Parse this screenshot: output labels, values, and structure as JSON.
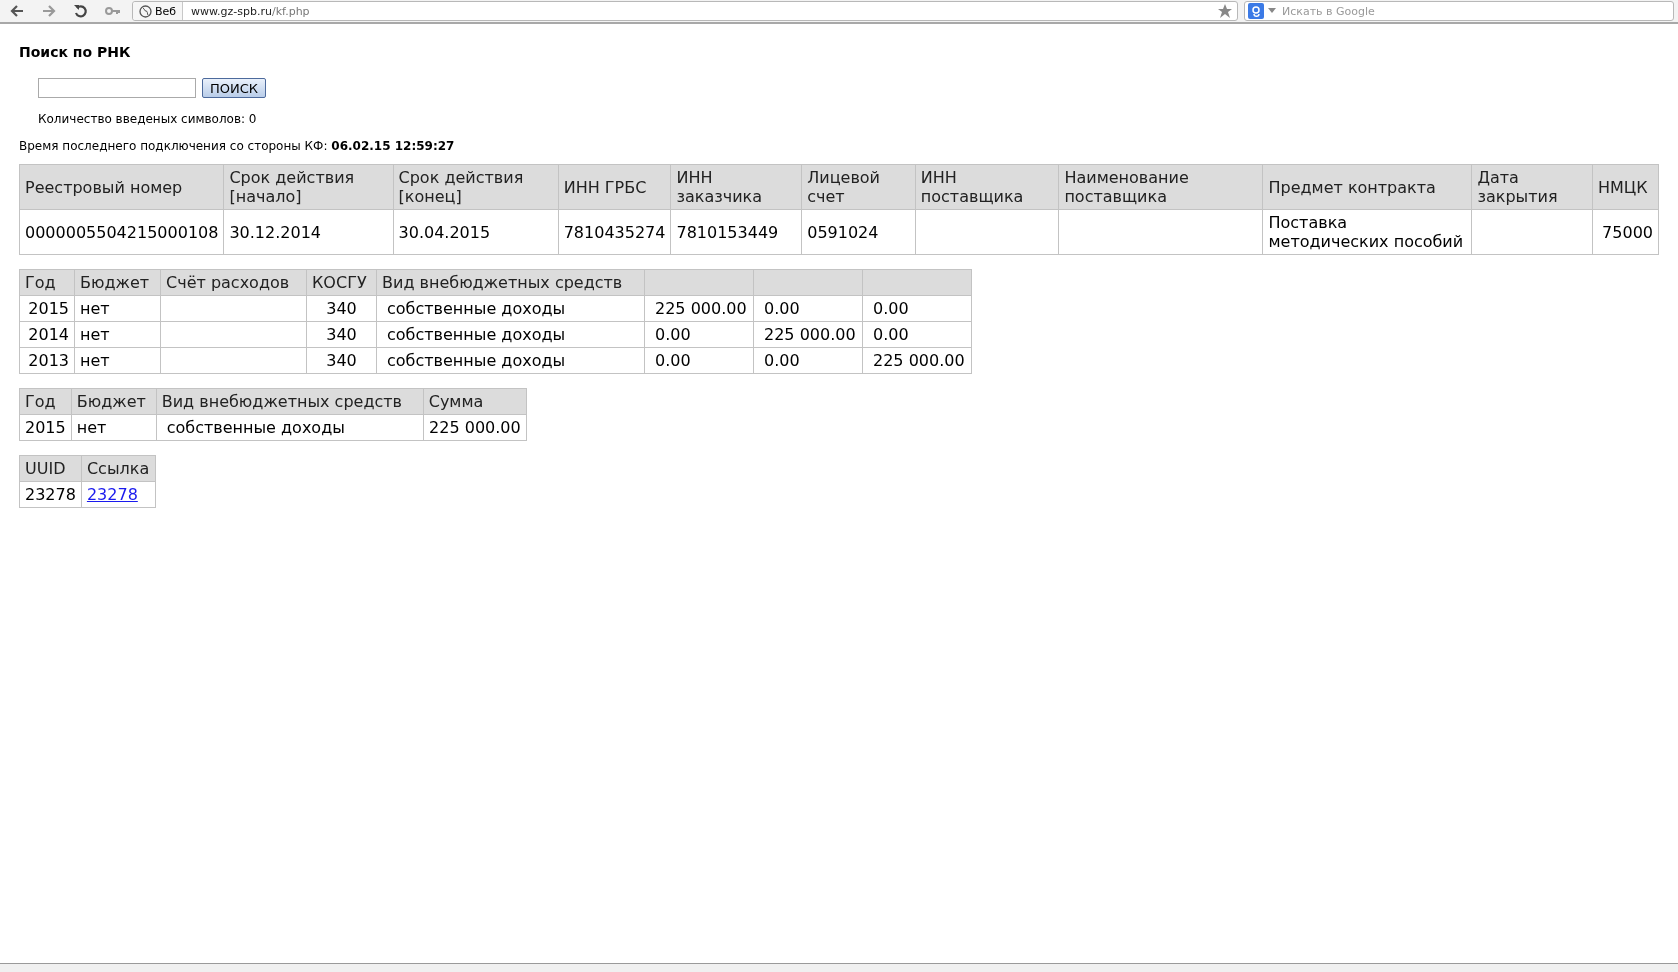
{
  "browser": {
    "search_engine_label": "Веб",
    "url_host": "www.gz-spb.ru",
    "url_path": "/kf.php",
    "web_search": {
      "placeholder": "Искать в Google"
    }
  },
  "page": {
    "title": "Поиск по РНК",
    "search": {
      "button": "ПОИСК"
    },
    "char_count": "Количество введеных символов: 0",
    "connection_label": "Время последнего подключения со стороны КФ:",
    "connection_time": "06.02.15 12:59:27"
  },
  "tables": [
    {
      "columns": [
        "Реестровый номер",
        "Срок действия [начало]",
        "Срок действия [конец]",
        "ИНН ГРБС",
        "ИНН заказчика",
        "Лицевой счет",
        "ИНН поставщика",
        "Наименование поставщика",
        "Предмет контракта",
        "Дата закрытия",
        "НМЦК"
      ],
      "rows": [
        [
          "0000005504215000108",
          "30.12.2014",
          "30.04.2015",
          "7810435274",
          "7810153449",
          "0591024",
          null,
          null,
          "Поставка методических пособий",
          null,
          "75000"
        ]
      ]
    },
    {
      "columns": [
        "Год",
        "Бюджет",
        "Счёт расходов",
        "КОСГУ",
        "Вид внебюджетных средств",
        null,
        null,
        null
      ],
      "rows": [
        [
          "2015",
          "нет",
          null,
          "340",
          "собственные доходы",
          "225 000.00",
          "0.00",
          "0.00"
        ],
        [
          "2014",
          "нет",
          null,
          "340",
          "собственные доходы",
          "0.00",
          "225 000.00",
          "0.00"
        ],
        [
          "2013",
          "нет",
          null,
          "340",
          "собственные доходы",
          "0.00",
          "0.00",
          "225 000.00"
        ]
      ]
    },
    {
      "columns": [
        "Год",
        "Бюджет",
        "Вид внебюджетных средств",
        "Сумма"
      ],
      "rows": [
        [
          "2015",
          "нет",
          "собственные доходы",
          "225 000.00"
        ]
      ]
    }
  ],
  "links_table": {
    "columns": [
      "UUID",
      "Ссылка"
    ],
    "rows": [
      {
        "uuid": "23278",
        "link": "23278"
      }
    ]
  }
}
